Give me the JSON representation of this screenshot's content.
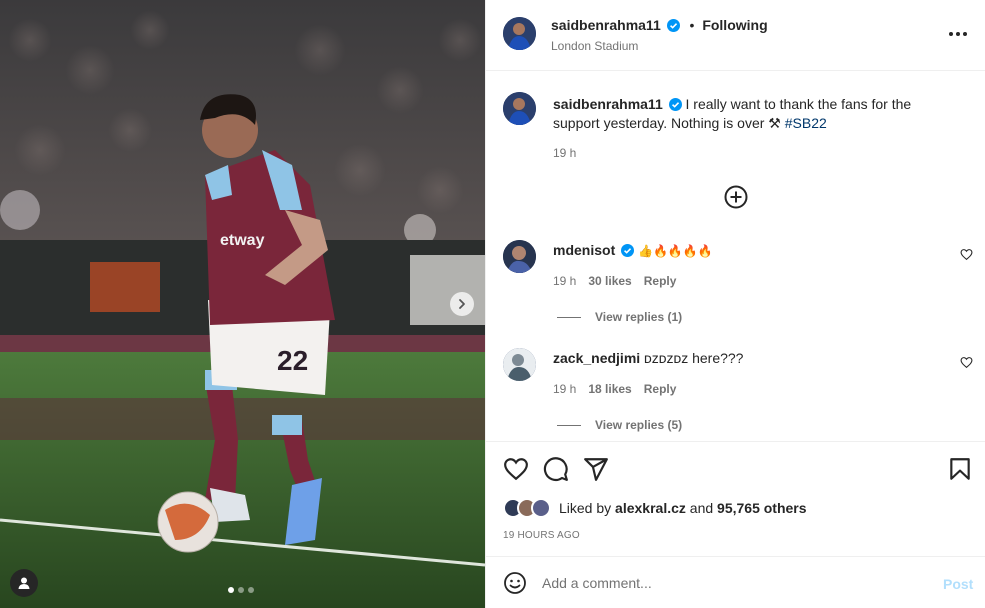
{
  "post": {
    "author": "saidbenrahma11",
    "follow_separator": "•",
    "follow_status": "Following",
    "location": "London Stadium",
    "caption_user": "saidbenrahma11",
    "caption_text": "I really want to thank the fans for the support yesterday. Nothing is over ⚒ ",
    "caption_hashtag": "#SB22",
    "caption_time": "19 h"
  },
  "media": {
    "jersey_number": "22",
    "sponsor": "Betway",
    "slide_count": 3,
    "active_slide": 1
  },
  "comments": [
    {
      "user": "mdenisot",
      "verified": true,
      "text": "👍🔥🔥🔥🔥",
      "time": "19 h",
      "likes": "30 likes",
      "reply": "Reply",
      "view_replies": "View replies (1)"
    },
    {
      "user": "zack_nedjimi",
      "verified": false,
      "text": "ᴅᴢᴅᴢᴅᴢ here???",
      "time": "19 h",
      "likes": "18 likes",
      "reply": "Reply",
      "view_replies": "View replies (5)"
    }
  ],
  "likes": {
    "prefix": "Liked by",
    "user": "alexkral.cz",
    "and": "and",
    "others": "95,765 others"
  },
  "timestamp": "19 HOURS AGO",
  "comment_box": {
    "placeholder": "Add a comment...",
    "post_label": "Post"
  },
  "colors": {
    "verified": "#0095f6",
    "hashtag": "#00376b",
    "secondary_text": "#737373",
    "post_disabled": "#b2dffc",
    "jersey_claret": "#7a263a",
    "jersey_blue": "#8fc4e6"
  },
  "icons": [
    "more-icon",
    "verified-icon",
    "plus-circle-icon",
    "heart-icon",
    "comment-icon",
    "share-icon",
    "bookmark-icon",
    "emoji-icon",
    "chevron-right-icon",
    "user-tag-icon"
  ]
}
